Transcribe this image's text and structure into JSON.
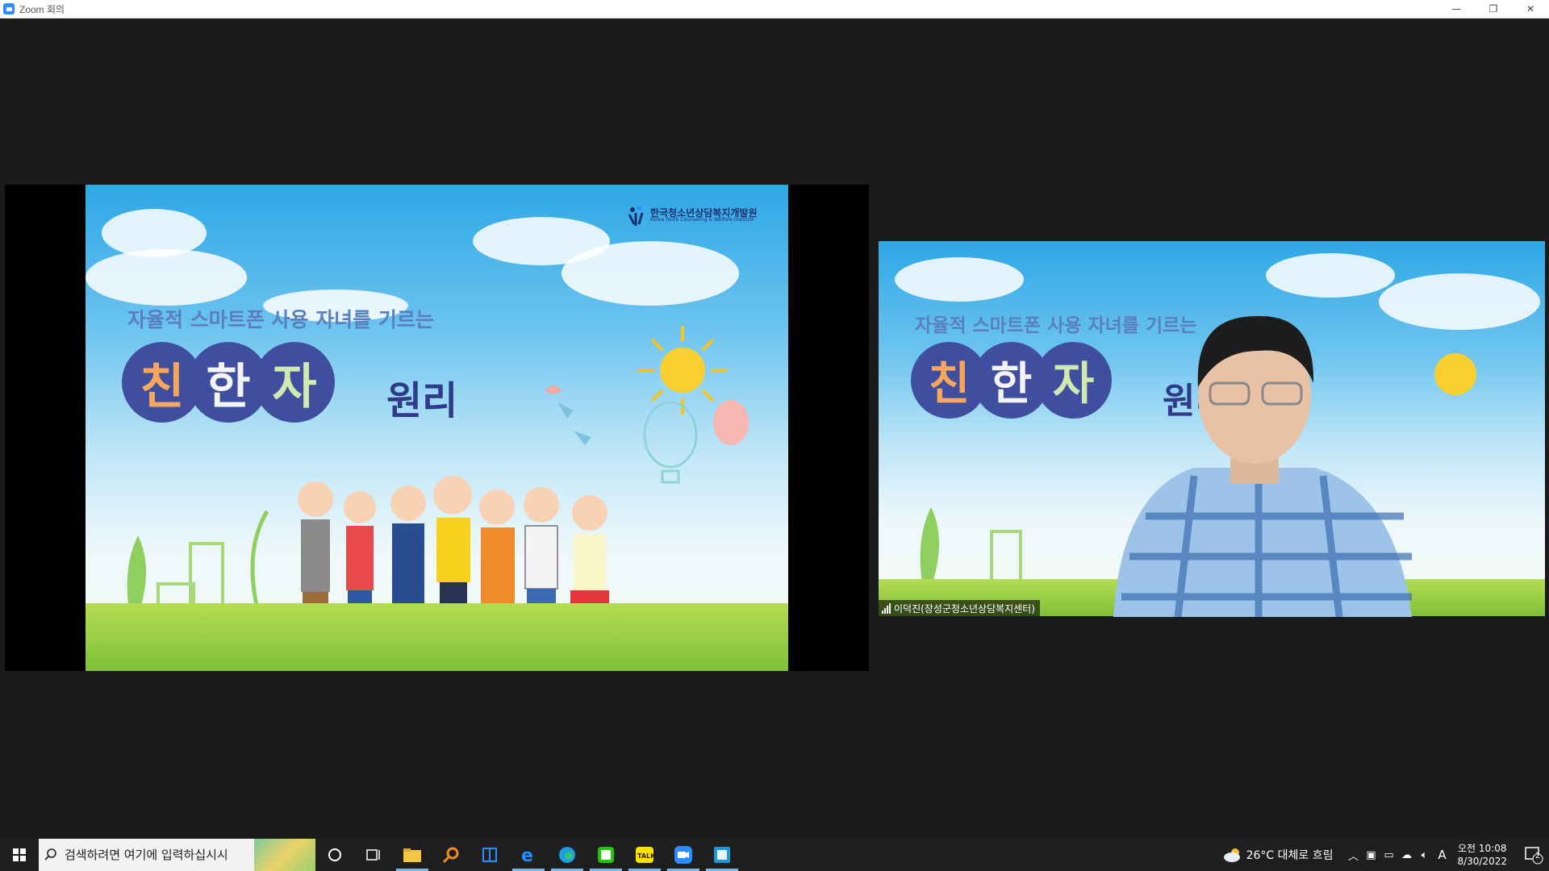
{
  "window": {
    "title": "Zoom 회의",
    "controls": {
      "minimize": "—",
      "restore": "❐",
      "close": "✕"
    }
  },
  "slide": {
    "subtitle": "자율적 스마트폰 사용 자녀를 기르는",
    "chars": [
      "친",
      "한",
      "자"
    ],
    "suffix": "원리",
    "logo_ko": "한국청소년상담복지개발원",
    "logo_en": "Korea Youth Counseling & Welfare Institute"
  },
  "participant": {
    "name": "이덕진(장성군청소년상담복지센터)"
  },
  "taskbar": {
    "search_placeholder": "검색하려면 여기에 입력하십시시",
    "weather": "26°C  대체로 흐림",
    "ime": "A",
    "clock_time": "오전 10:08",
    "clock_date": "8/30/2022",
    "notification_count": "2",
    "apps": [
      "file-explorer",
      "search-app",
      "network-app",
      "internet-explorer",
      "edge",
      "naver-app",
      "kakaotalk",
      "zoom",
      "calculator"
    ]
  },
  "colors": {
    "accent": "#2d8cff",
    "circle": "#3f4e9e",
    "taskbar": "#1f1f1f"
  }
}
